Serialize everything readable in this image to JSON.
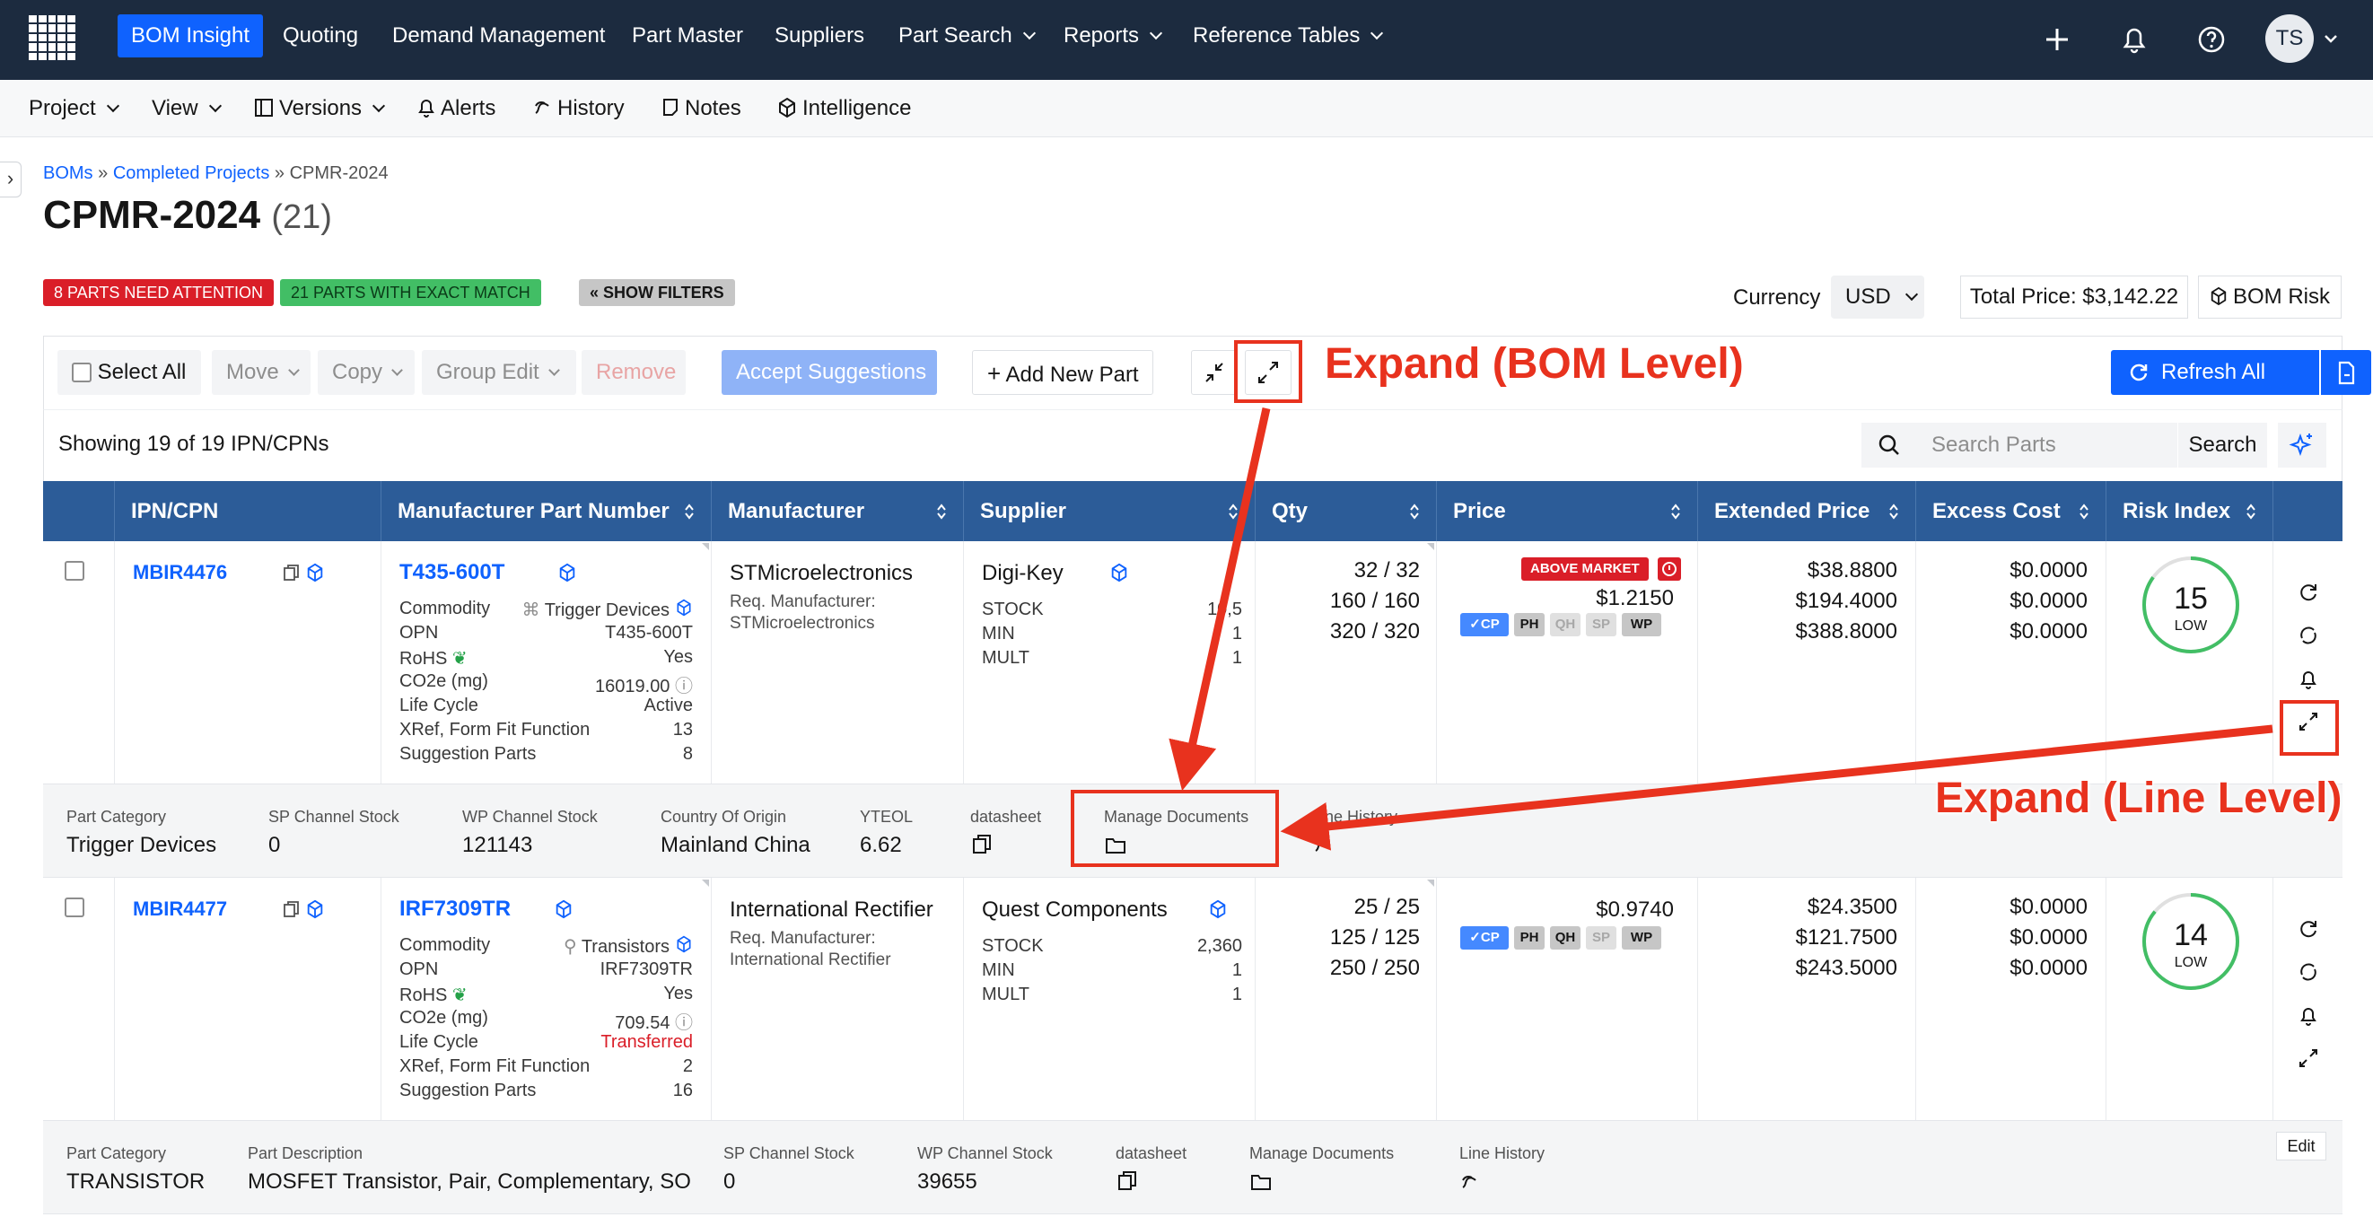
{
  "topnav": {
    "items": [
      "BOM Insight",
      "Quoting",
      "Demand Management",
      "Part Master",
      "Suppliers",
      "Part Search",
      "Reports",
      "Reference Tables"
    ],
    "avatar": "TS"
  },
  "subnav": {
    "items": [
      "Project",
      "View",
      "Versions",
      "Alerts",
      "History",
      "Notes",
      "Intelligence"
    ]
  },
  "breadcrumb": {
    "root": "BOMs",
    "sep1": "»",
    "parent": "Completed Projects",
    "sep2": "»",
    "current": "CPMR-2024"
  },
  "title": {
    "name": "CPMR-2024",
    "count": "(21)"
  },
  "badges": {
    "attention": "8 PARTS NEED ATTENTION",
    "exact": "21 PARTS WITH EXACT MATCH",
    "filters": "« SHOW FILTERS"
  },
  "header_right": {
    "currency_label": "Currency",
    "currency_value": "USD",
    "total_price": "Total Price: $3,142.22",
    "bom_risk": "BOM Risk"
  },
  "toolbar": {
    "select_all": "Select All",
    "move": "Move",
    "copy": "Copy",
    "group_edit": "Group Edit",
    "remove": "Remove",
    "accept": "Accept Suggestions",
    "add_new": "Add New Part",
    "refresh_all": "Refresh All"
  },
  "list": {
    "showing": "Showing 19 of 19 IPN/CPNs",
    "search_placeholder": "Search Parts",
    "search_button": "Search"
  },
  "columns": [
    "IPN/CPN",
    "Manufacturer Part Number",
    "Manufacturer",
    "Supplier",
    "Qty",
    "Price",
    "Extended Price",
    "Excess Cost",
    "Risk Index"
  ],
  "rows": [
    {
      "ipn": "MBIR4476",
      "mpn": "T435-600T",
      "attrs": [
        {
          "k": "Commodity",
          "v": "Trigger Devices"
        },
        {
          "k": "OPN",
          "v": "T435-600T"
        },
        {
          "k": "RoHS",
          "v": "Yes"
        },
        {
          "k": "CO2e (mg)",
          "v": "16019.00"
        },
        {
          "k": "Life Cycle",
          "v": "Active"
        },
        {
          "k": "XRef, Form Fit Function",
          "v": "13"
        },
        {
          "k": "Suggestion Parts",
          "v": "8"
        }
      ],
      "manufacturer": "STMicroelectronics",
      "req_label": "Req. Manufacturer:",
      "req_mfr": "STMicroelectronics",
      "supplier": "Digi-Key",
      "stock": [
        {
          "k": "STOCK",
          "v": "10,5"
        },
        {
          "k": "MIN",
          "v": "1"
        },
        {
          "k": "MULT",
          "v": "1"
        }
      ],
      "qty": [
        "32 / 32",
        "160 / 160",
        "320 / 320"
      ],
      "above_market": "ABOVE MARKET",
      "price": "$1.2150",
      "chips": [
        "✓CP",
        "PH",
        "QH",
        "SP",
        "WP"
      ],
      "ext_price": [
        "$38.8800",
        "$194.4000",
        "$388.8000"
      ],
      "excess": [
        "$0.0000",
        "$0.0000",
        "$0.0000"
      ],
      "risk": "15",
      "risk_label": "LOW",
      "risk_fraction": 0.15
    },
    {
      "ipn": "MBIR4477",
      "mpn": "IRF7309TR",
      "attrs": [
        {
          "k": "Commodity",
          "v": "Transistors"
        },
        {
          "k": "OPN",
          "v": "IRF7309TR"
        },
        {
          "k": "RoHS",
          "v": "Yes"
        },
        {
          "k": "CO2e (mg)",
          "v": "709.54"
        },
        {
          "k": "Life Cycle",
          "v": "Transferred"
        },
        {
          "k": "XRef, Form Fit Function",
          "v": "2"
        },
        {
          "k": "Suggestion Parts",
          "v": "16"
        }
      ],
      "manufacturer": "International Rectifier",
      "req_label": "Req. Manufacturer:",
      "req_mfr": "International Rectifier",
      "supplier": "Quest Components",
      "stock": [
        {
          "k": "STOCK",
          "v": "2,360"
        },
        {
          "k": "MIN",
          "v": "1"
        },
        {
          "k": "MULT",
          "v": "1"
        }
      ],
      "qty": [
        "25 / 25",
        "125 / 125",
        "250 / 250"
      ],
      "price": "$0.9740",
      "chips": [
        "✓CP",
        "PH",
        "QH",
        "SP",
        "WP"
      ],
      "ext_price": [
        "$24.3500",
        "$121.7500",
        "$243.5000"
      ],
      "excess": [
        "$0.0000",
        "$0.0000",
        "$0.0000"
      ],
      "risk": "14",
      "risk_label": "LOW",
      "risk_fraction": 0.14
    }
  ],
  "details": [
    {
      "items": [
        {
          "k": "Part Category",
          "v": "Trigger Devices"
        },
        {
          "k": "SP Channel Stock",
          "v": "0"
        },
        {
          "k": "WP Channel Stock",
          "v": "121143"
        },
        {
          "k": "Country Of Origin",
          "v": "Mainland China"
        },
        {
          "k": "YTEOL",
          "v": "6.62"
        },
        {
          "k": "datasheet",
          "v": ""
        },
        {
          "k": "Manage Documents",
          "v": ""
        },
        {
          "k": "Line History",
          "v": ""
        }
      ]
    },
    {
      "items": [
        {
          "k": "Part Category",
          "v": "TRANSISTOR"
        },
        {
          "k": "Part Description",
          "v": "MOSFET Transistor, Pair, Complementary, SO"
        },
        {
          "k": "SP Channel Stock",
          "v": "0"
        },
        {
          "k": "WP Channel Stock",
          "v": "39655"
        },
        {
          "k": "datasheet",
          "v": ""
        },
        {
          "k": "Manage Documents",
          "v": ""
        },
        {
          "k": "Line History",
          "v": ""
        }
      ],
      "edit": "Edit"
    }
  ],
  "annotations": {
    "bom_level": "Expand (BOM Level)",
    "line_level": "Expand (Line Level)"
  },
  "colors": {
    "nav_bg": "#1c2b3f",
    "accent": "#0f62fe",
    "header_bg": "#2c5c98",
    "annotation": "#e8321e",
    "danger": "#da1e28",
    "success": "#42be65"
  }
}
